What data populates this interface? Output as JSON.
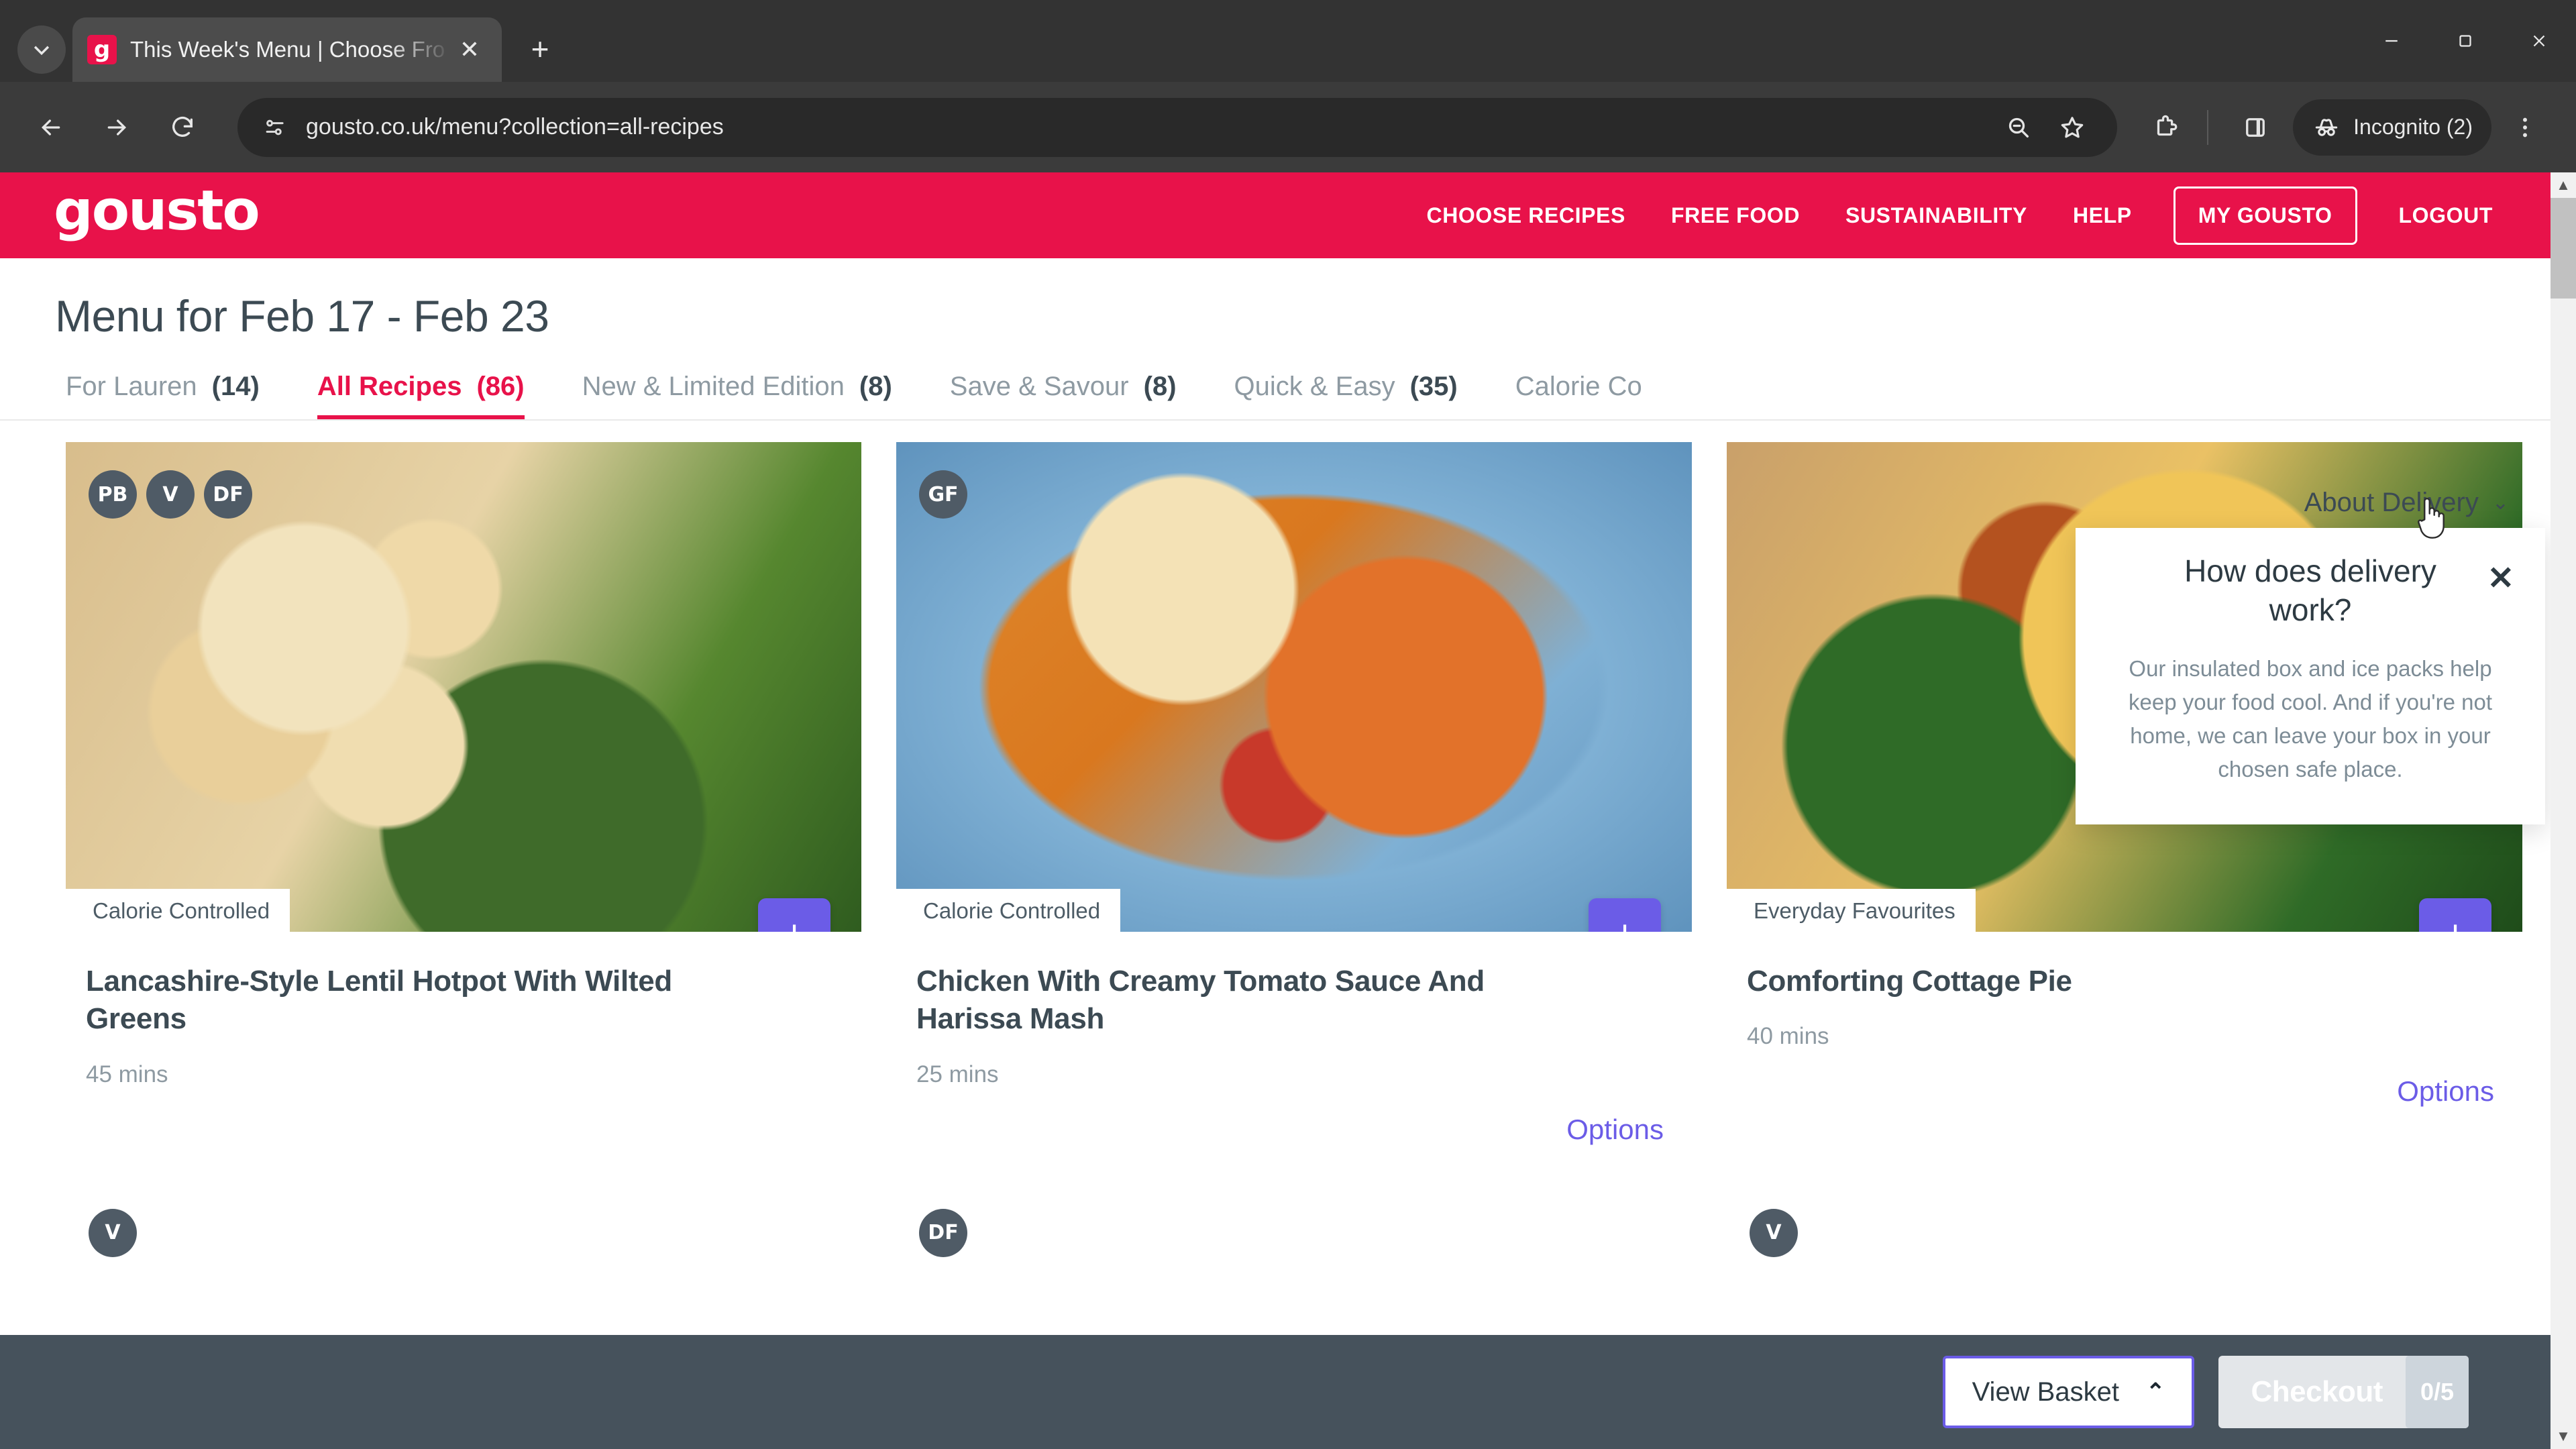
{
  "browser": {
    "tab": {
      "title": "This Week's Menu | Choose Fro",
      "favicon_letter": "g"
    },
    "url": "gousto.co.uk/menu?collection=all-recipes",
    "profile_label": "Incognito (2)",
    "icons": {
      "tab_list": "chevron-down-icon",
      "new_tab": "+",
      "minimize": "minimize-icon",
      "maximize": "maximize-icon",
      "close": "close-icon",
      "back": "back-arrow-icon",
      "forward": "forward-arrow-icon",
      "reload": "reload-icon",
      "site_info": "site-settings-icon",
      "zoom_out": "zoom-out-icon",
      "bookmark": "star-icon",
      "extensions": "extensions-puzzle-icon",
      "side_panel": "side-panel-icon",
      "incognito": "incognito-hat-icon",
      "menu": "three-dot-menu-icon"
    }
  },
  "site": {
    "brand": "gousto",
    "nav": [
      {
        "label": "CHOOSE RECIPES",
        "style": "plain"
      },
      {
        "label": "FREE FOOD",
        "style": "plain"
      },
      {
        "label": "SUSTAINABILITY",
        "style": "plain"
      },
      {
        "label": "HELP",
        "style": "plain"
      },
      {
        "label": "MY GOUSTO",
        "style": "outline"
      },
      {
        "label": "LOGOUT",
        "style": "plain"
      }
    ],
    "brand_color": "#e8124a",
    "accent_color": "#6b5ce7"
  },
  "page": {
    "title": "Menu for Feb 17 - Feb 23",
    "tabs": [
      {
        "label": "For Lauren",
        "count": "(14)",
        "active": false
      },
      {
        "label": "All Recipes",
        "count": "(86)",
        "active": true
      },
      {
        "label": "New & Limited Edition",
        "count": "(8)",
        "active": false
      },
      {
        "label": "Save & Savour",
        "count": "(8)",
        "active": false
      },
      {
        "label": "Quick & Easy",
        "count": "(35)",
        "active": false
      },
      {
        "label": "Calorie Co",
        "count": "",
        "active": false
      }
    ],
    "about_delivery": {
      "label": "About Delivery",
      "chevron": "chevron-down-icon"
    },
    "tooltip": {
      "heading": "How does delivery work?",
      "body": "Our insulated box and ice packs help keep your food cool. And if you're not home, we can leave your box in your chosen safe place.",
      "close": "✕"
    }
  },
  "recipes": [
    {
      "badges": [
        "PB",
        "V",
        "DF"
      ],
      "category": "Calorie Controlled",
      "title": "Lancashire-Style Lentil Hotpot With Wilted Greens",
      "time": "45 mins",
      "add_label": "+",
      "options_label": ""
    },
    {
      "badges": [
        "GF"
      ],
      "category": "Calorie Controlled",
      "title": "Chicken With Creamy Tomato Sauce And Harissa Mash",
      "time": "25 mins",
      "add_label": "+",
      "options_label": "Options"
    },
    {
      "badges": [],
      "category": "Everyday Favourites",
      "title": "Comforting Cottage Pie",
      "time": "40 mins",
      "add_label": "+",
      "options_label": "Options"
    }
  ],
  "recipes_row2": [
    {
      "badges": [
        "V"
      ]
    },
    {
      "badges": [
        "DF"
      ]
    },
    {
      "badges": [
        "V"
      ]
    }
  ],
  "basket_bar": {
    "view_basket_label": "View Basket",
    "view_basket_chevron": "chevron-up-icon",
    "checkout_label": "Checkout",
    "checkout_count": "0/5"
  }
}
